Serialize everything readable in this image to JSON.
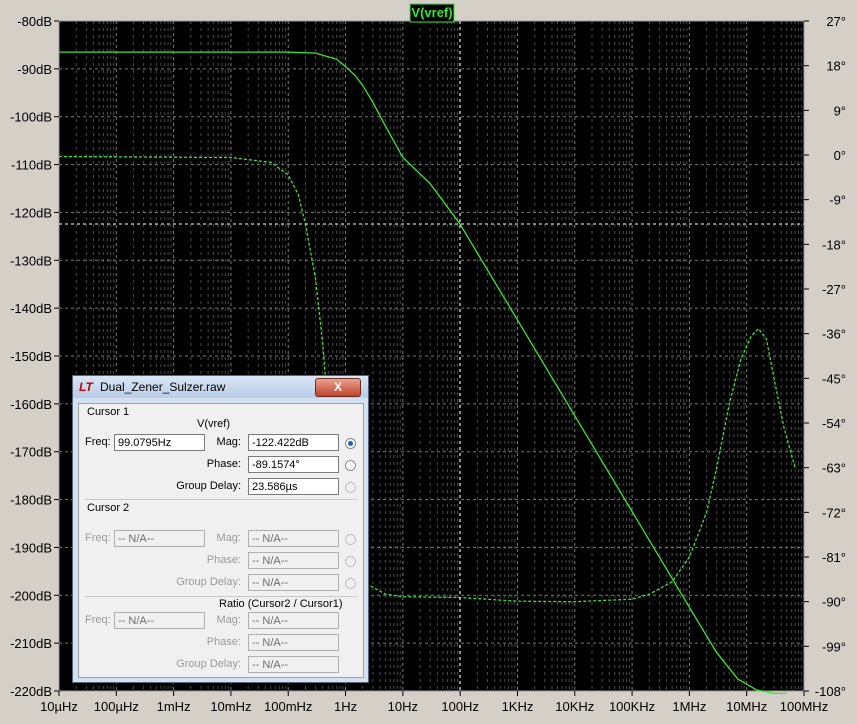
{
  "window": {
    "title": "Dual_Zener_Sulzer.raw",
    "close_label": "X"
  },
  "chart_data": {
    "type": "line",
    "title": "V(vref)",
    "x_scale": "log",
    "x_ticks": [
      {
        "value": 1e-05,
        "label": "10µHz"
      },
      {
        "value": 0.0001,
        "label": "100µHz"
      },
      {
        "value": 0.001,
        "label": "1mHz"
      },
      {
        "value": 0.01,
        "label": "10mHz"
      },
      {
        "value": 0.1,
        "label": "100mHz"
      },
      {
        "value": 1,
        "label": "1Hz"
      },
      {
        "value": 10,
        "label": "10Hz"
      },
      {
        "value": 100,
        "label": "100Hz"
      },
      {
        "value": 1000,
        "label": "1KHz"
      },
      {
        "value": 10000,
        "label": "10KHz"
      },
      {
        "value": 100000,
        "label": "100KHz"
      },
      {
        "value": 1000000,
        "label": "1MHz"
      },
      {
        "value": 10000000,
        "label": "10MHz"
      },
      {
        "value": 100000000,
        "label": "100MHz"
      }
    ],
    "xlim": [
      1e-05,
      100000000
    ],
    "ylim_left": [
      -220,
      -80
    ],
    "y_ticks_left": [
      {
        "value": -80,
        "label": "-80dB"
      },
      {
        "value": -90,
        "label": "-90dB"
      },
      {
        "value": -100,
        "label": "-100dB"
      },
      {
        "value": -110,
        "label": "-110dB"
      },
      {
        "value": -120,
        "label": "-120dB"
      },
      {
        "value": -130,
        "label": "-130dB"
      },
      {
        "value": -140,
        "label": "-140dB"
      },
      {
        "value": -150,
        "label": "-150dB"
      },
      {
        "value": -160,
        "label": "-160dB"
      },
      {
        "value": -170,
        "label": "-170dB"
      },
      {
        "value": -180,
        "label": "-180dB"
      },
      {
        "value": -190,
        "label": "-190dB"
      },
      {
        "value": -200,
        "label": "-200dB"
      },
      {
        "value": -210,
        "label": "-210dB"
      },
      {
        "value": -220,
        "label": "-220dB"
      }
    ],
    "ylim_right": [
      -108,
      27
    ],
    "y_ticks_right": [
      {
        "value": 27,
        "label": "27°"
      },
      {
        "value": 18,
        "label": "18°"
      },
      {
        "value": 9,
        "label": "9°"
      },
      {
        "value": 0,
        "label": "0°"
      },
      {
        "value": -9,
        "label": "-9°"
      },
      {
        "value": -18,
        "label": "-18°"
      },
      {
        "value": -27,
        "label": "-27°"
      },
      {
        "value": -36,
        "label": "-36°"
      },
      {
        "value": -45,
        "label": "-45°"
      },
      {
        "value": -54,
        "label": "-54°"
      },
      {
        "value": -63,
        "label": "-63°"
      },
      {
        "value": -72,
        "label": "-72°"
      },
      {
        "value": -81,
        "label": "-81°"
      },
      {
        "value": -90,
        "label": "-90°"
      },
      {
        "value": -99,
        "label": "-99°"
      },
      {
        "value": -108,
        "label": "-108°"
      }
    ],
    "grid": true,
    "background": "#000000",
    "trace_color": "#38e830",
    "series": [
      {
        "name": "V(vref)",
        "quantity": "magnitude",
        "axis": "left",
        "style": "solid",
        "points": [
          [
            1e-05,
            -86.5
          ],
          [
            0.1,
            -86.5
          ],
          [
            0.3,
            -86.7
          ],
          [
            0.7,
            -88
          ],
          [
            1,
            -89.5
          ],
          [
            1.5,
            -91.5
          ],
          [
            2,
            -93.5
          ],
          [
            3,
            -97
          ],
          [
            5,
            -102
          ],
          [
            10,
            -108.5
          ],
          [
            30,
            -114
          ],
          [
            99.08,
            -122.4
          ],
          [
            1000,
            -142.5
          ],
          [
            10000,
            -162.5
          ],
          [
            100000,
            -182.5
          ],
          [
            1000000,
            -202.5
          ],
          [
            3000000,
            -212
          ],
          [
            7000000,
            -217.5
          ],
          [
            15000000,
            -219.8
          ],
          [
            30000000,
            -220.5
          ],
          [
            50000000,
            -220.5
          ]
        ]
      },
      {
        "name": "V(vref)",
        "quantity": "phase",
        "axis": "right",
        "style": "dashed",
        "points": [
          [
            1e-05,
            -0.3
          ],
          [
            0.01,
            -0.5
          ],
          [
            0.05,
            -1.5
          ],
          [
            0.1,
            -4
          ],
          [
            0.15,
            -8
          ],
          [
            0.2,
            -14
          ],
          [
            0.3,
            -25
          ],
          [
            0.4,
            -38
          ],
          [
            0.5,
            -52
          ],
          [
            0.6,
            -63
          ],
          [
            0.8,
            -74
          ],
          [
            1,
            -80
          ],
          [
            2,
            -86
          ],
          [
            5,
            -88.5
          ],
          [
            10,
            -89
          ],
          [
            99.08,
            -89.16
          ],
          [
            1000,
            -89.9
          ],
          [
            10000,
            -90
          ],
          [
            100000,
            -89.5
          ],
          [
            200000,
            -88.5
          ],
          [
            500000,
            -86
          ],
          [
            1000000,
            -81
          ],
          [
            2000000,
            -72
          ],
          [
            3000000,
            -63
          ],
          [
            5000000,
            -50
          ],
          [
            8000000,
            -41
          ],
          [
            12000000,
            -36.5
          ],
          [
            16000000,
            -35
          ],
          [
            22000000,
            -37
          ],
          [
            30000000,
            -45
          ],
          [
            45000000,
            -55
          ],
          [
            70000000,
            -63
          ]
        ]
      }
    ],
    "cursor": {
      "x": 99.0795,
      "y_db": -122.422
    }
  },
  "cursor1": {
    "header": "Cursor 1",
    "trace": "V(vref)",
    "freq_label": "Freq:",
    "freq": "99.0795Hz",
    "mag_label": "Mag:",
    "mag": "-122.422dB",
    "phase_label": "Phase:",
    "phase": "-89.1574°",
    "gd_label": "Group Delay:",
    "gd": "23.586µs"
  },
  "cursor2": {
    "header": "Cursor 2",
    "freq_label": "Freq:",
    "freq": "-- N/A--",
    "mag_label": "Mag:",
    "mag": "-- N/A--",
    "phase_label": "Phase:",
    "phase": "-- N/A--",
    "gd_label": "Group Delay:",
    "gd": "-- N/A--"
  },
  "ratio": {
    "header": "Ratio (Cursor2 / Cursor1)",
    "freq_label": "Freq:",
    "freq": "-- N/A--",
    "mag_label": "Mag:",
    "mag": "-- N/A--",
    "phase_label": "Phase:",
    "phase": "-- N/A--",
    "gd_label": "Group Delay:",
    "gd": "-- N/A--"
  }
}
